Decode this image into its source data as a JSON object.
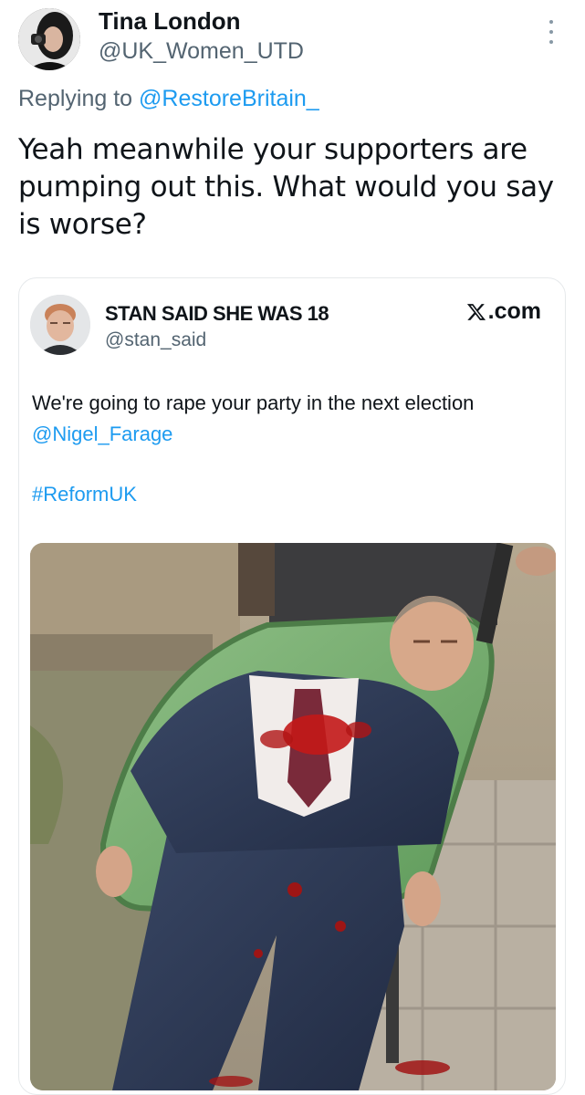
{
  "author": {
    "name": "Tina London",
    "handle": "@UK_Women_UTD"
  },
  "reply": {
    "prefix": "Replying to ",
    "target": "@RestoreBritain_"
  },
  "tweet_text": "Yeah meanwhile your supporters are pumping out this. What would you say is worse?",
  "quote": {
    "name": "STAN SAID SHE WAS 18",
    "handle": "@stan_said",
    "source_label": ".com",
    "text": "We're going to rape your party in the next election ",
    "mention": "@Nigel_Farage",
    "hashtag": "#ReformUK"
  },
  "icons": {
    "more": "more-vertical-icon",
    "x_logo": "x-logo-icon"
  },
  "colors": {
    "link": "#1d9bf0",
    "secondary_text": "#536471",
    "primary_text": "#0f1419"
  }
}
